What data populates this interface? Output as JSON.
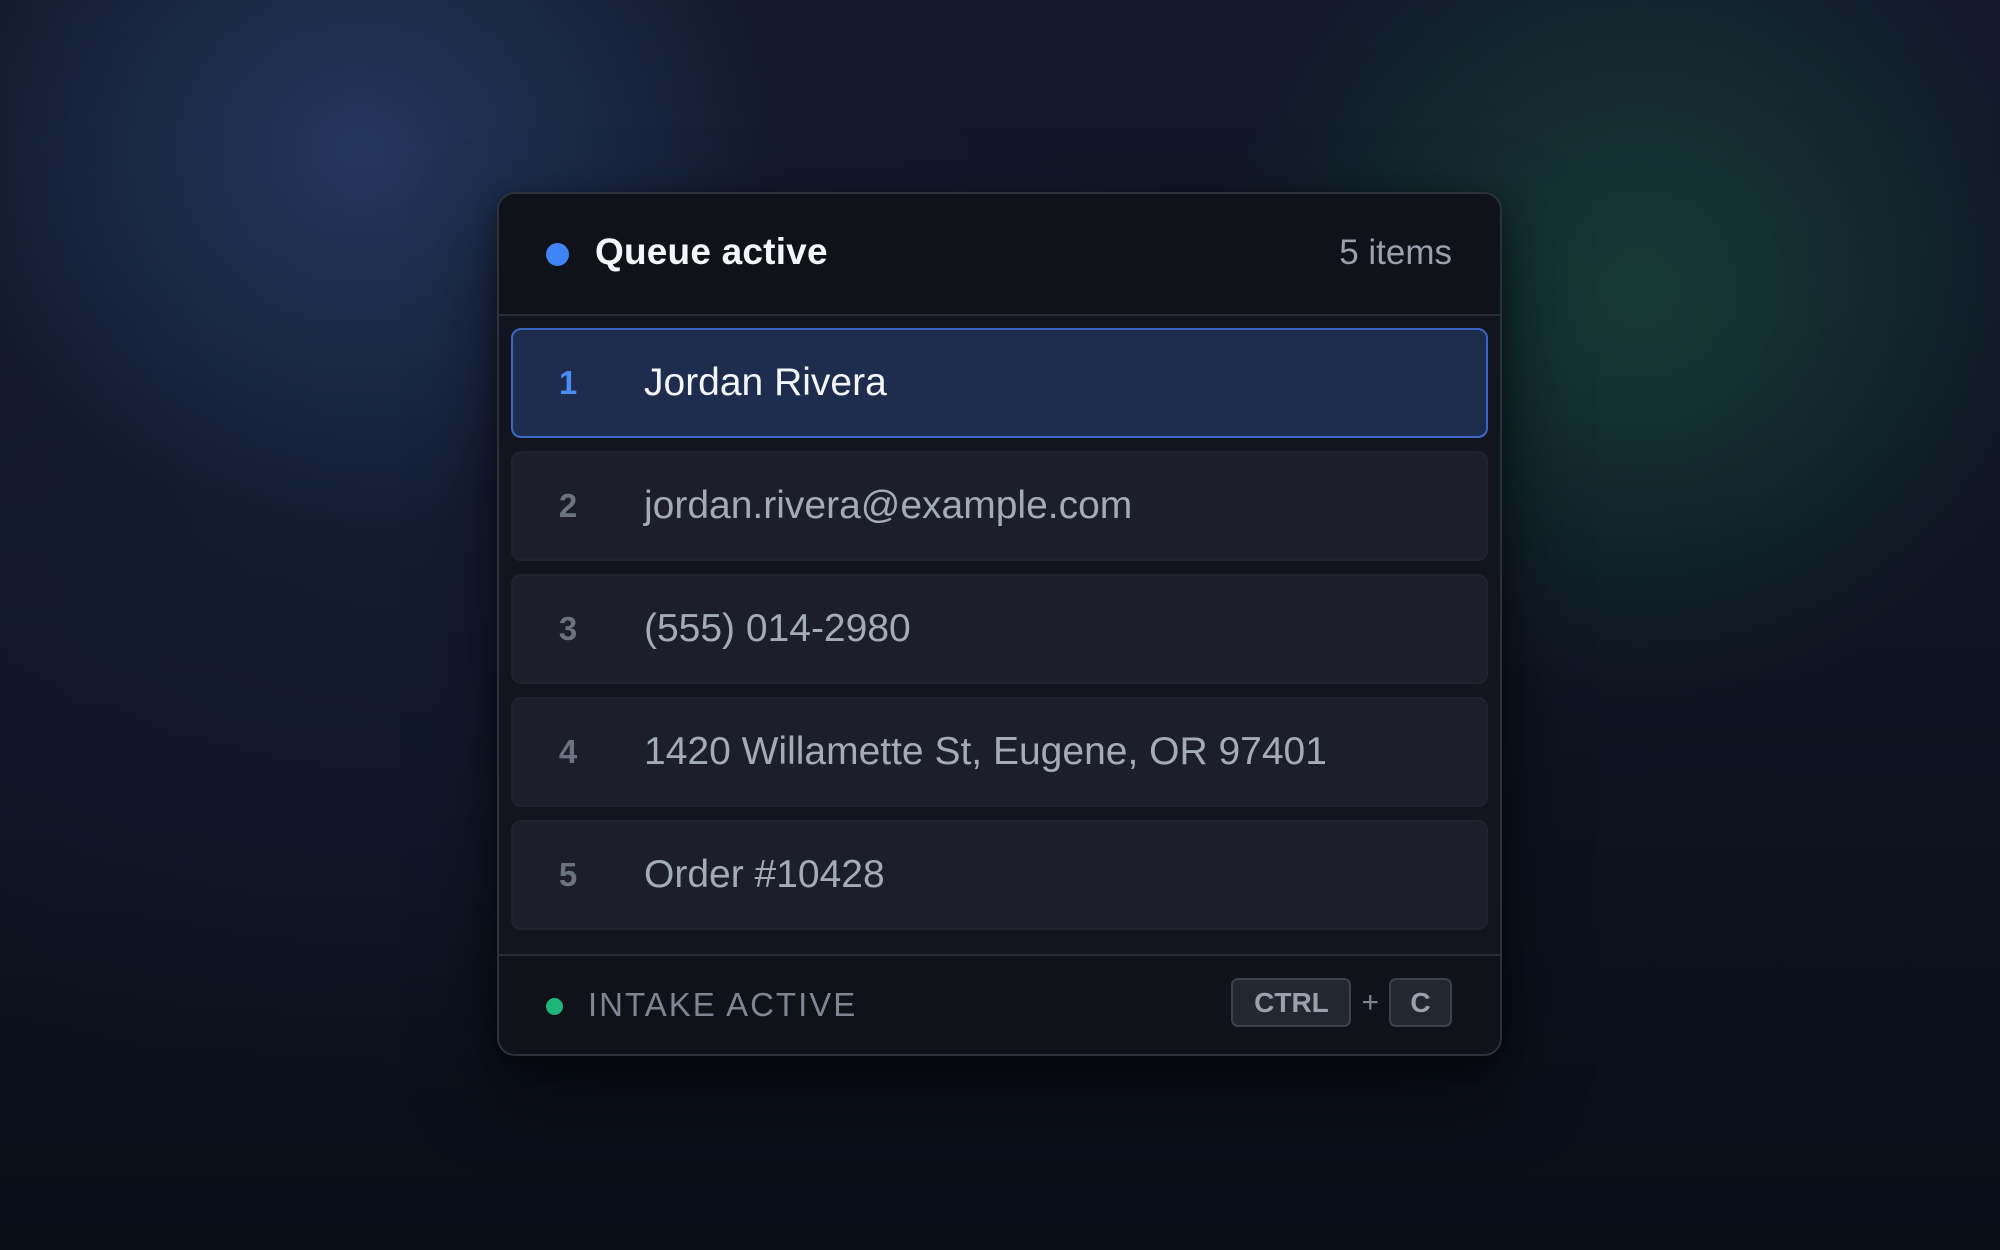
{
  "header": {
    "title": "Queue active",
    "count": "5 items",
    "status_color": "#3f84f4"
  },
  "queue": {
    "items": [
      {
        "index": "1",
        "text": "Jordan Rivera",
        "selected": true
      },
      {
        "index": "2",
        "text": "jordan.rivera@example.com",
        "selected": false
      },
      {
        "index": "3",
        "text": "(555) 014-2980",
        "selected": false
      },
      {
        "index": "4",
        "text": "1420 Willamette St, Eugene, OR 97401",
        "selected": false
      },
      {
        "index": "5",
        "text": "Order #10428",
        "selected": false
      }
    ]
  },
  "footer": {
    "status_label": "INTAKE ACTIVE",
    "status_color": "#1fb67a",
    "shortcut": {
      "key1": "CTRL",
      "separator": "+",
      "key2": "C"
    }
  },
  "colors": {
    "accent": "#3f84f4",
    "selected_row_bg": "#1e2c4d",
    "selected_row_border": "#3a67c4"
  }
}
